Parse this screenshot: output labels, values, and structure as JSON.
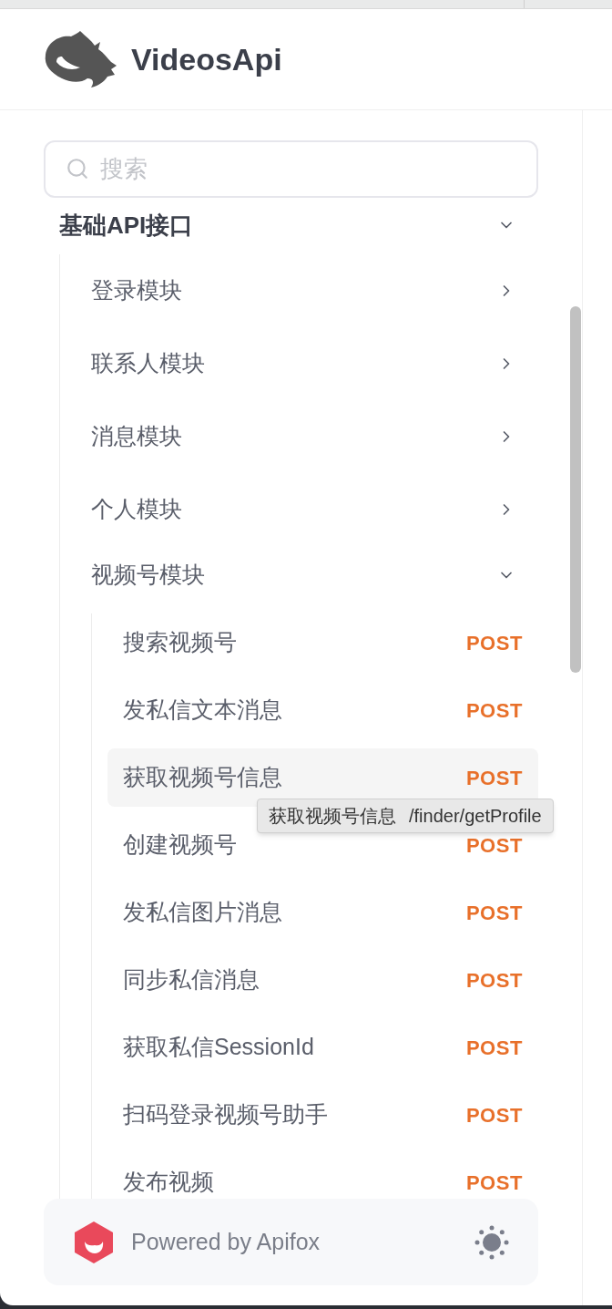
{
  "brand": {
    "title": "VideosApi"
  },
  "search": {
    "placeholder": "搜索"
  },
  "tree": [
    {
      "label": "基础API接口",
      "expanded": true,
      "children": [
        {
          "label": "登录模块",
          "expanded": false
        },
        {
          "label": "联系人模块",
          "expanded": false
        },
        {
          "label": "消息模块",
          "expanded": false
        },
        {
          "label": "个人模块",
          "expanded": false
        },
        {
          "label": "视频号模块",
          "expanded": true,
          "children": [
            {
              "label": "搜索视频号",
              "method": "POST",
              "selected": false
            },
            {
              "label": "发私信文本消息",
              "method": "POST",
              "selected": false
            },
            {
              "label": "获取视频号信息",
              "method": "POST",
              "selected": true
            },
            {
              "label": "创建视频号",
              "method": "POST",
              "selected": false
            },
            {
              "label": "发私信图片消息",
              "method": "POST",
              "selected": false
            },
            {
              "label": "同步私信消息",
              "method": "POST",
              "selected": false
            },
            {
              "label": "获取私信SessionId",
              "method": "POST",
              "selected": false
            },
            {
              "label": "扫码登录视频号助手",
              "method": "POST",
              "selected": false
            },
            {
              "label": "发布视频",
              "method": "POST",
              "selected": false
            }
          ]
        }
      ]
    }
  ],
  "tooltip": {
    "name": "获取视频号信息",
    "path": "/finder/getProfile"
  },
  "footer": {
    "text": "Powered by Apifox"
  }
}
